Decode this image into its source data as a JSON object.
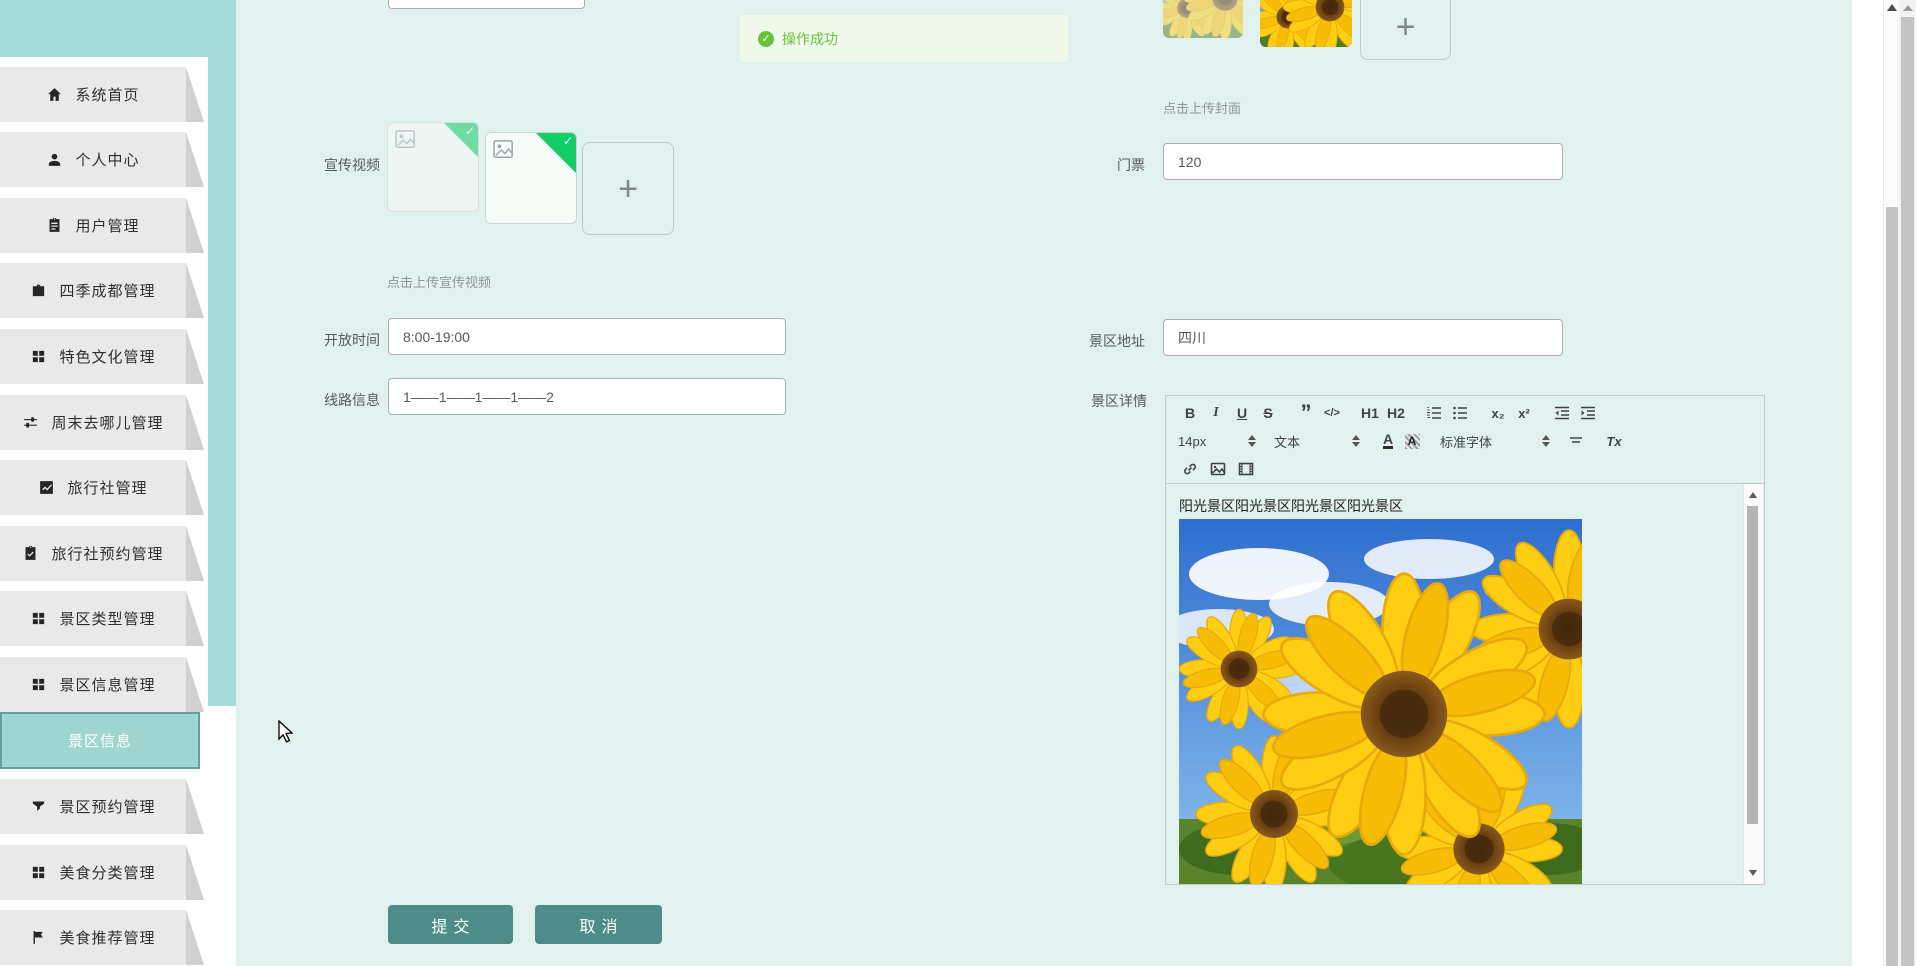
{
  "colors": {
    "accent": "#4e8c89",
    "sidebar_teal": "#a5dcd8",
    "content_bg": "#e1f1ee",
    "success": "#67c23a",
    "selected_item_bg": "#9fd6d2"
  },
  "sidebar": {
    "items": [
      {
        "label": "系统首页",
        "icon": "home"
      },
      {
        "label": "个人中心",
        "icon": "person"
      },
      {
        "label": "用户管理",
        "icon": "clipboard"
      },
      {
        "label": "四季成都管理",
        "icon": "briefcase"
      },
      {
        "label": "特色文化管理",
        "icon": "grid"
      },
      {
        "label": "周末去哪儿管理",
        "icon": "sliders"
      },
      {
        "label": "旅行社管理",
        "icon": "chart"
      },
      {
        "label": "旅行社预约管理",
        "icon": "clipboard-check"
      },
      {
        "label": "景区类型管理",
        "icon": "grid"
      },
      {
        "label": "景区信息管理",
        "icon": "grid"
      },
      {
        "label": "景区信息",
        "selected": true
      },
      {
        "label": "景区预约管理",
        "icon": "filter"
      },
      {
        "label": "美食分类管理",
        "icon": "grid"
      },
      {
        "label": "美食推荐管理",
        "icon": "flag"
      }
    ]
  },
  "alert": {
    "icon": "✓",
    "text": "操作成功"
  },
  "cover": {
    "hint": "点击上传封面"
  },
  "video": {
    "label": "宣传视频",
    "hint": "点击上传宣传视频",
    "upload_plus": "+"
  },
  "form": {
    "open_time": {
      "label": "开放时间",
      "value": "8:00-19:00"
    },
    "route_info": {
      "label": "线路信息",
      "value": "1——1——1——1——2"
    },
    "ticket": {
      "label": "门票",
      "value": "120"
    },
    "address": {
      "label": "景区地址",
      "value": "四川"
    },
    "detail": {
      "label": "景区详情"
    }
  },
  "editor": {
    "toolbar": {
      "bold": "B",
      "italic": "I",
      "underline": "U",
      "strike": "S",
      "quote": "”",
      "code": "</>",
      "h1": "H1",
      "h2": "H2",
      "sub": "x₂",
      "sup": "x²",
      "color": "A",
      "background": "A",
      "size_value": "14px",
      "block_value": "文本",
      "font_value": "标准字体",
      "clean": "Tx"
    },
    "content_text": "阳光景区阳光景区阳光景区阳光景区"
  },
  "buttons": {
    "submit": "提交",
    "cancel": "取消"
  }
}
